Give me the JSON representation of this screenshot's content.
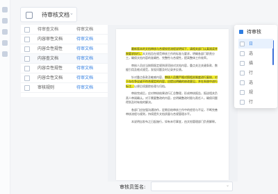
{
  "toolbar": {
    "dropdown_label": "待审核文档"
  },
  "table": {
    "header": {
      "col1": "待审查文档",
      "col2": "待审文档"
    },
    "rows": [
      {
        "col1": "内容审性文档",
        "col2": "待审文档"
      },
      {
        "col1": "内容合性规性",
        "col2": "待审文档"
      },
      {
        "col1": "内容查文档",
        "col2": "待审文档"
      },
      {
        "col1": "内容合性规性",
        "col2": "待审文档"
      },
      {
        "col1": "内容合性文档",
        "col2": "待审文档"
      },
      {
        "col1": "审核规则",
        "col2": "待审文档"
      }
    ]
  },
  "document": {
    "p1_hl": "最新版本的文档审核与合规校验流程说明如下，请相关部门认真阅读并按要求执行。",
    "p1_rest": "本文档旨在规范审核工作的标准与要求，明确各部门职责分工，确保文档内容的准确性、完整性与合规性，提高整体工作效率。",
    "p2": "审核人员应当按照既定规则逐项核对文档内容，重点关注关键条款、数据引用及格式规范，发现问题及时记录并反馈。",
    "p3_a": "针对重点条款及敏感内容，",
    "p3_hl": "审核人员需严格对照相关制度进行复核，对于存在争议或不符合规定的内容，应提出明确的修改意见，并在系统中进行标注，",
    "p3_b": "以便后续跟踪处理与归档。",
    "p4": "审核完成后，应对审核结果进行汇总整理，形成审核报告，报送相关负责人审阅确认。对于需要整改的内容，应明确整改时限与责任人，确保问题得到及时有效的解决。",
    "p5": "各部门应加强沟通协作，定期总结审核工作中的经验与不足，不断完善审核流程与规则，持续提升文档质量与合规管理水平。",
    "p6": "本说明自发布之日起施行，如有未尽事宜，由文档管理部门负责解释。"
  },
  "footer": {
    "label": "审核员签名:",
    "select_value": ""
  },
  "popup": {
    "title": "待审核",
    "items": [
      "日",
      "选",
      "描",
      "行",
      "选",
      "规",
      "行"
    ]
  },
  "colors": {
    "accent": "#2f7de1",
    "highlight": "#f3ee2a"
  }
}
